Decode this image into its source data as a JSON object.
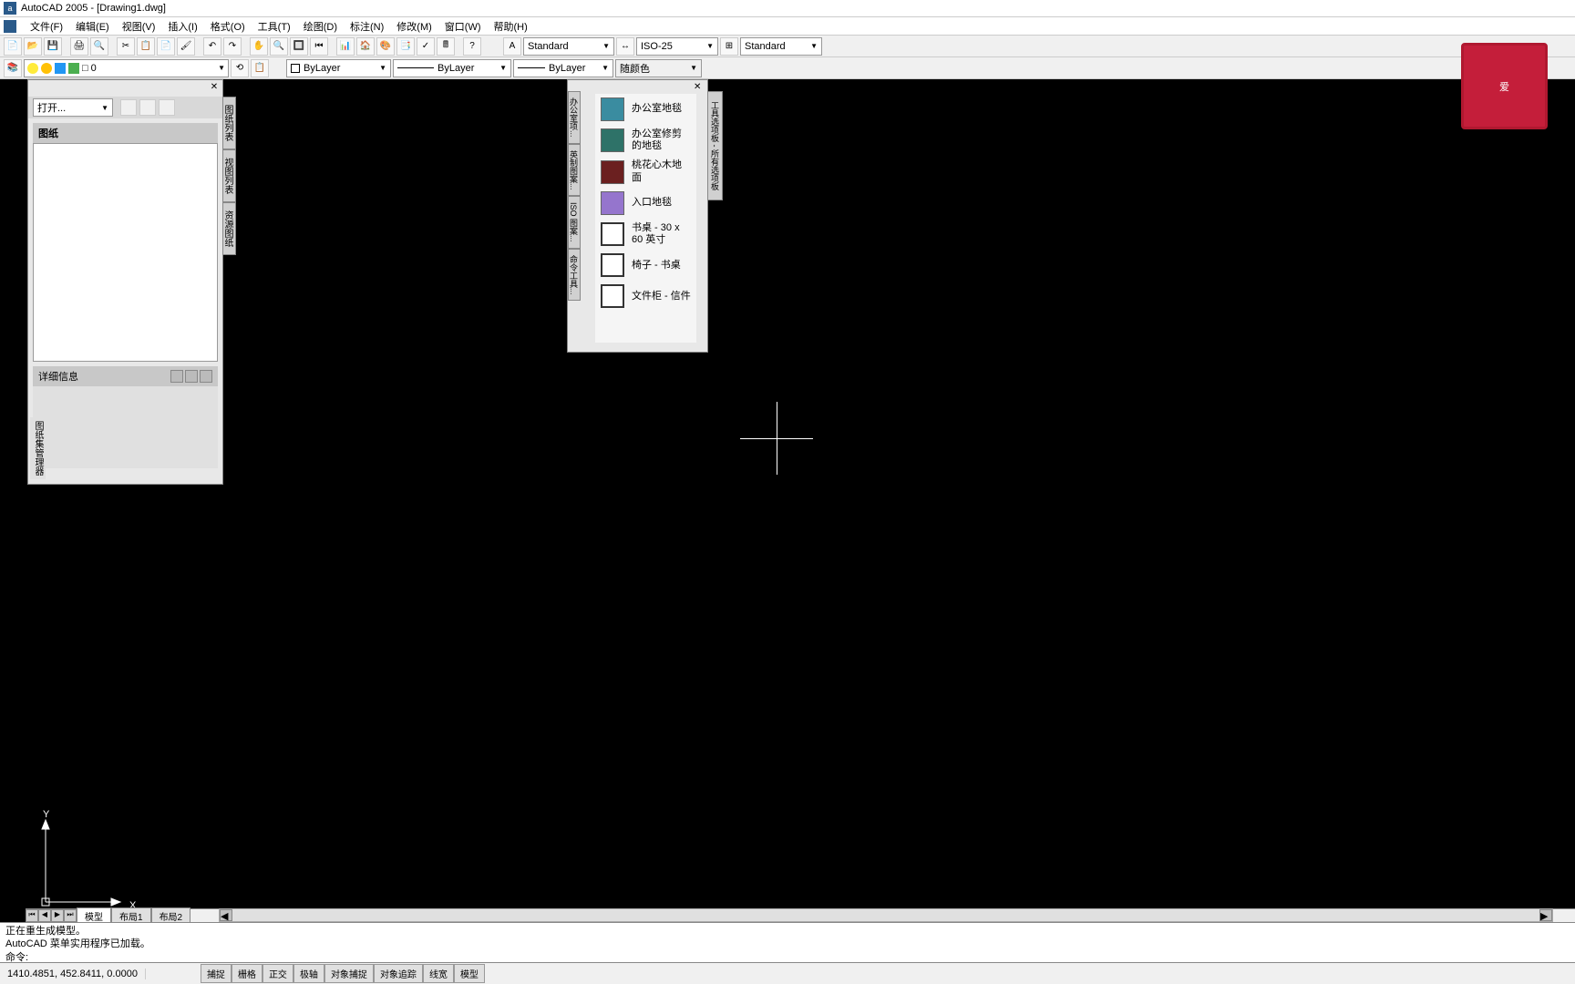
{
  "title": "AutoCAD 2005 - [Drawing1.dwg]",
  "menus": {
    "file": "文件(F)",
    "edit": "编辑(E)",
    "view": "视图(V)",
    "insert": "插入(I)",
    "format": "格式(O)",
    "tools": "工具(T)",
    "draw": "绘图(D)",
    "dimension": "标注(N)",
    "modify": "修改(M)",
    "window": "窗口(W)",
    "help": "帮助(H)"
  },
  "text_style": "Standard",
  "dim_style": "ISO-25",
  "table_style": "Standard",
  "layer": {
    "name": "0",
    "symbol": "□"
  },
  "linetype": "ByLayer",
  "lineweight": "ByLayer",
  "plot_style": "ByLayer",
  "color_control": "随颜色",
  "palette": {
    "open_label": "打开...",
    "drawings_title": "图纸",
    "details_title": "详细信息",
    "side_tabs": [
      "图纸列表",
      "视图列表",
      "资源图纸"
    ],
    "left_label": "图纸集管理器"
  },
  "tool_palette": {
    "left_tabs": [
      "办公室项...",
      "英制图案...",
      "ISO 图案...",
      "命令工具..."
    ],
    "right_tab": "工具选项板 - 所有选项板",
    "items": [
      {
        "color": "#3a8ca0",
        "label": "办公室地毯"
      },
      {
        "color": "#2e7268",
        "label": "办公室修剪的地毯"
      },
      {
        "color": "#6b2020",
        "label": "桃花心木地面"
      },
      {
        "color": "#9575cd",
        "label": "入口地毯"
      },
      {
        "color": "#fff",
        "border": true,
        "label": "书桌 - 30 x 60 英寸"
      },
      {
        "color": "#fff",
        "border": true,
        "label": "椅子 - 书桌"
      },
      {
        "color": "#fff",
        "border": true,
        "label": "文件柜 - 信件"
      }
    ]
  },
  "tabs": {
    "model": "模型",
    "layout1": "布局1",
    "layout2": "布局2"
  },
  "cmd": {
    "line1": "正在重生成模型。",
    "line2": "AutoCAD 菜单实用程序已加载。",
    "prompt": "命令:"
  },
  "status": {
    "coords": "1410.4851, 452.8411, 0.0000",
    "toggles": [
      "捕捉",
      "栅格",
      "正交",
      "极轴",
      "对象捕捉",
      "对象追踪",
      "线宽",
      "模型"
    ]
  },
  "ucs": {
    "x": "X",
    "y": "Y"
  },
  "watermark": "爱"
}
